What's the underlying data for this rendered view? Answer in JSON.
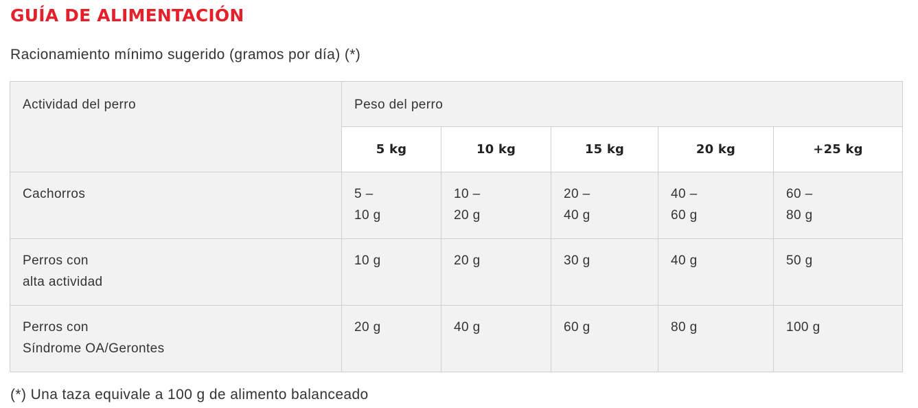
{
  "colors": {
    "title": "#e4212b",
    "text": "#333333",
    "header_bg": "#f2f2f2",
    "body_bg": "#f2f2f2",
    "weight_row_bg": "#ffffff",
    "border": "#cfcfcf"
  },
  "title": "GUÍA DE ALIMENTACIÓN",
  "subtitle": "Racionamiento mínimo sugerido (gramos por día) (*)",
  "table": {
    "activity_header": "Actividad del perro",
    "weight_header": "Peso del perro",
    "weights": [
      "5 kg",
      "10 kg",
      "15 kg",
      "20 kg",
      "+25 kg"
    ],
    "rows": [
      {
        "activity": "Cachorros",
        "values": [
          "5 –\n10 g",
          "10 –\n20 g",
          "20 –\n40 g",
          "40 –\n60 g",
          "60 –\n80 g"
        ]
      },
      {
        "activity": "Perros con\nalta actividad",
        "values": [
          "10 g",
          "20 g",
          "30 g",
          "40 g",
          "50 g"
        ]
      },
      {
        "activity": "Perros con\nSíndrome OA/Gerontes",
        "values": [
          "20 g",
          "40 g",
          "60 g",
          "80 g",
          "100 g"
        ]
      }
    ]
  },
  "footnote": "(*) Una taza equivale a 100 g de alimento balanceado"
}
